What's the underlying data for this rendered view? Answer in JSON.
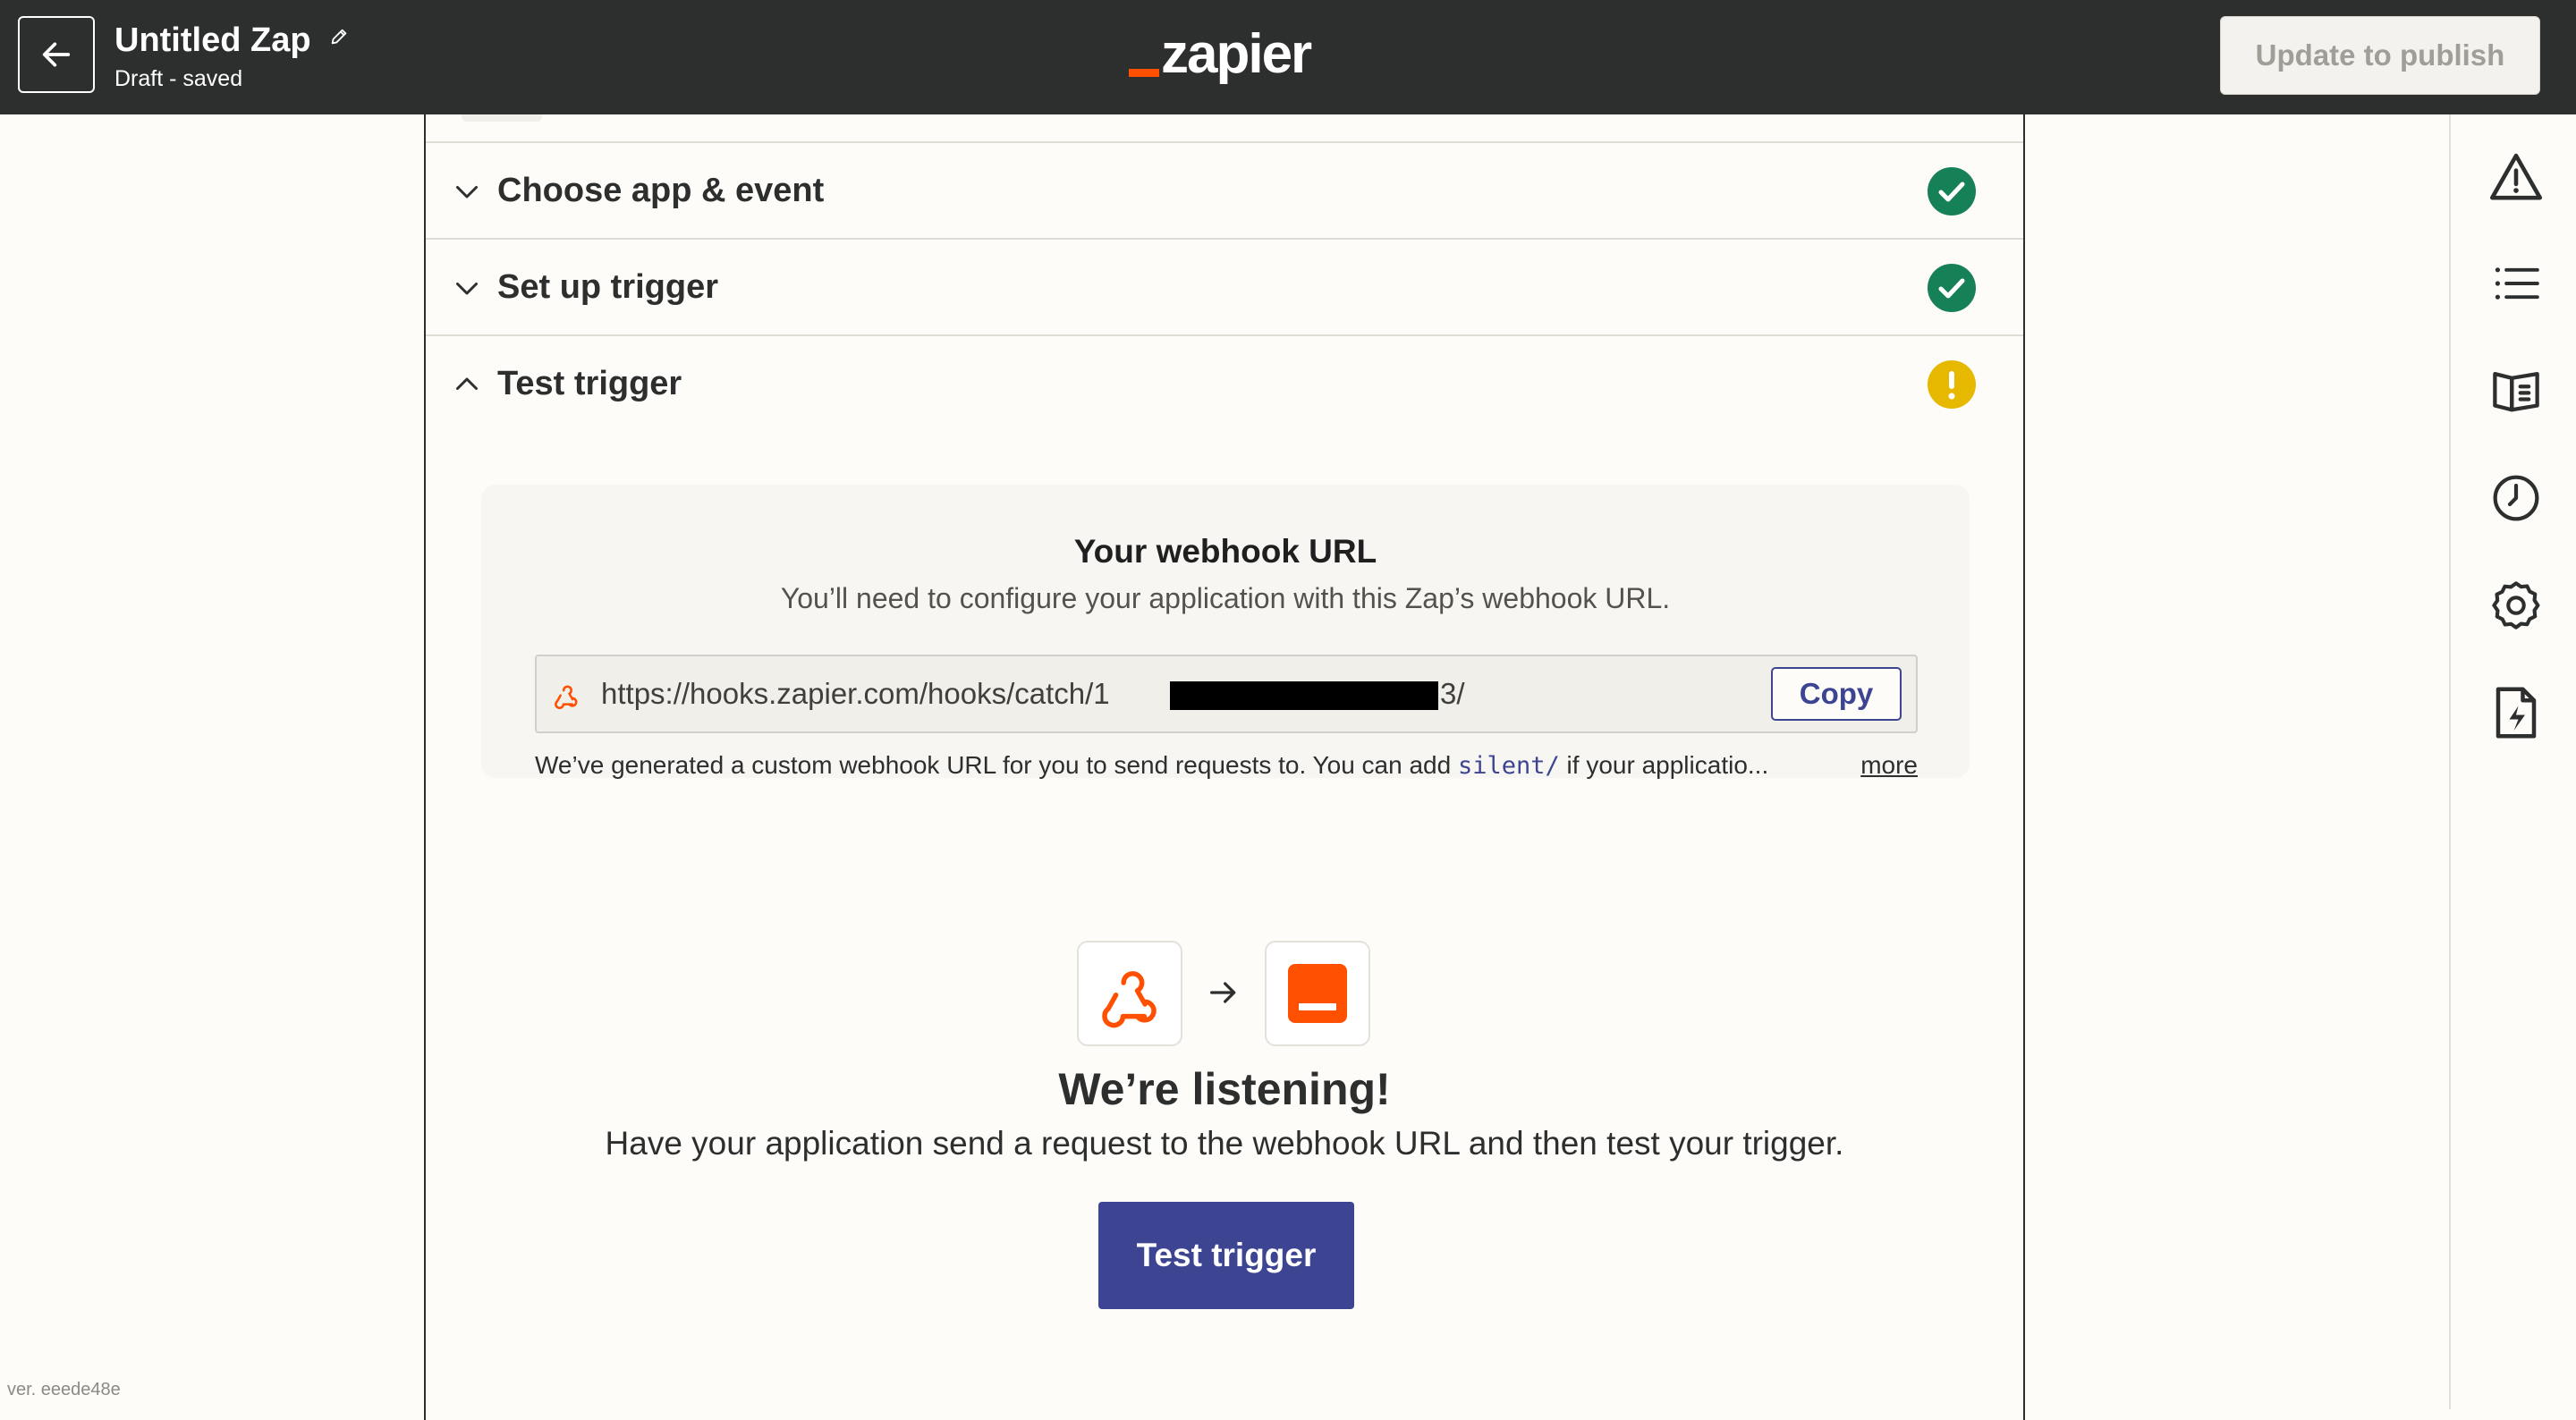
{
  "header": {
    "zap_title": "Untitled Zap",
    "zap_status": "Draft - saved",
    "logo_text": "zapier",
    "publish_label": "Update to publish"
  },
  "sections": [
    {
      "label": "Choose app & event",
      "state": "complete",
      "expanded": false
    },
    {
      "label": "Set up trigger",
      "state": "complete",
      "expanded": false
    },
    {
      "label": "Test trigger",
      "state": "warning",
      "expanded": true
    }
  ],
  "webhook": {
    "title": "Your webhook URL",
    "subtitle": "You’ll need to configure your application with this Zap’s webhook URL.",
    "url_prefix": "https://hooks.zapier.com/hooks/catch/1",
    "url_suffix": "3/",
    "copy_label": "Copy",
    "help_text_before": "We’ve generated a custom webhook URL for you to send requests to. You can add ",
    "help_code": "silent/",
    "help_text_after": " if your applicatio...",
    "more_label": "more"
  },
  "listening": {
    "title": "We’re listening!",
    "description": "Have your application send a request to the webhook URL and then test your trigger.",
    "button_label": "Test trigger"
  },
  "sidebar_icons": [
    "warning-icon",
    "list-icon",
    "book-icon",
    "clock-icon",
    "gear-icon",
    "file-bolt-icon"
  ],
  "version_text": "ver. eeede48e",
  "colors": {
    "topbar": "#2d2e2e",
    "brand_orange": "#ff4f00",
    "primary_blue": "#3d4592",
    "success_green": "#168057",
    "warning_yellow": "#e6b800"
  }
}
